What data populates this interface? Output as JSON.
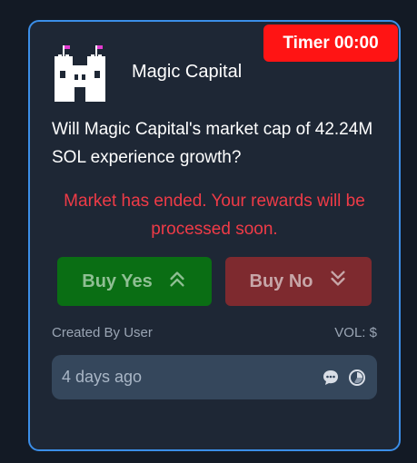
{
  "timer": {
    "label": "Timer 00:00"
  },
  "project": {
    "name": "Magic Capital"
  },
  "question": "Will Magic Capital's market cap of 42.24M SOL experience growth?",
  "status_message": "Market has ended. Your rewards will be processed soon.",
  "buttons": {
    "yes_label": "Buy Yes",
    "no_label": "Buy No"
  },
  "meta": {
    "created_by": "Created By User",
    "volume": "VOL: $"
  },
  "footer": {
    "time_ago": "4 days ago"
  },
  "icons": {
    "logo": "castle-logo-icon",
    "yes": "double-chevron-up-icon",
    "no": "double-chevron-down-icon",
    "comments": "chat-bubble-icon",
    "chart": "pie-chart-icon"
  },
  "colors": {
    "background": "#131a25",
    "card": "#1e2735",
    "card_border": "#3b8ee8",
    "timer": "#ff1414",
    "ended_text": "#ef3b47",
    "buy_yes": "#0a6e14",
    "buy_no": "#7e2a2f",
    "footer": "#35475c"
  }
}
